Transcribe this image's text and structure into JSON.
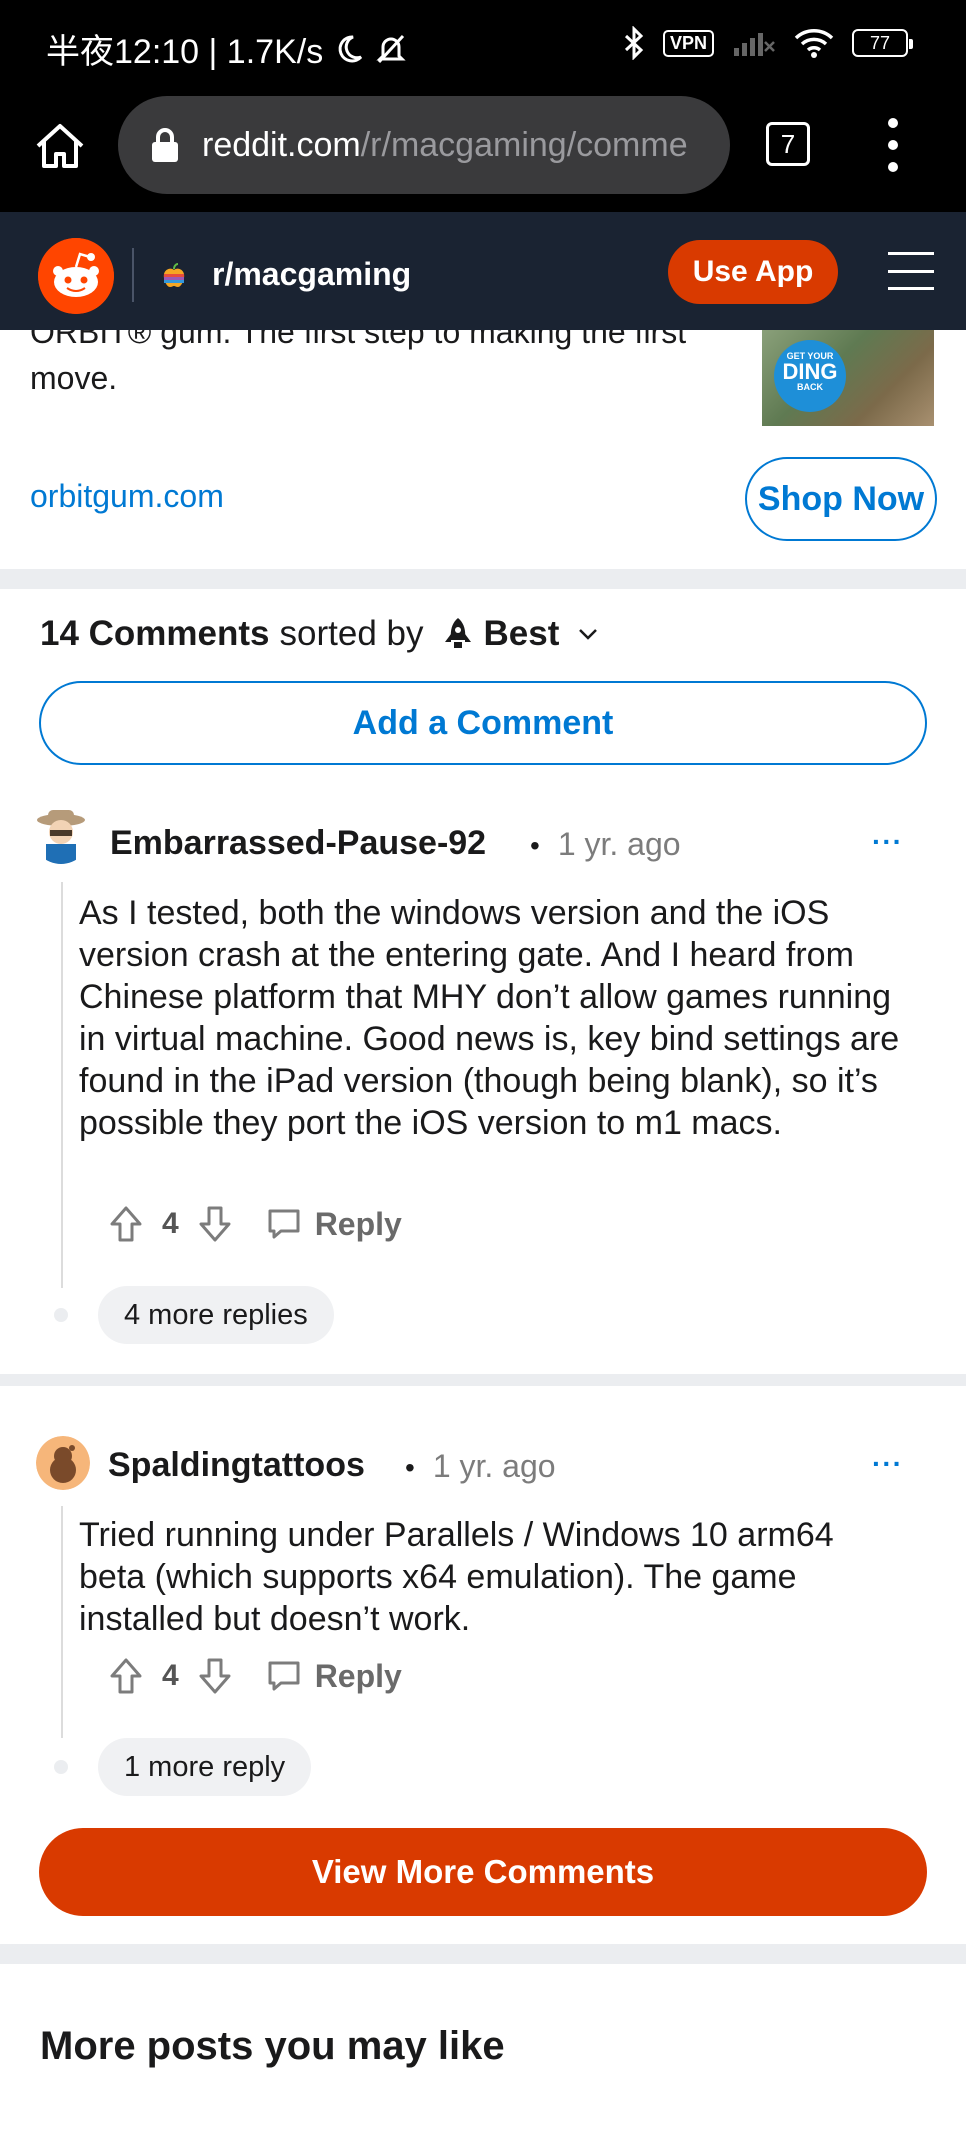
{
  "status_bar": {
    "left_text": "半夜12:10 | 1.7K/s",
    "vpn_label": "VPN",
    "battery": "77"
  },
  "browser": {
    "url_domain": "reddit.com",
    "url_path": "/r/macgaming/comme",
    "tab_count": "7"
  },
  "reddit_header": {
    "subreddit": "r/macgaming",
    "use_app_label": "Use App"
  },
  "ad": {
    "text_line_cut": "ORBIT® gum. The first step to making the first",
    "text_line": "move.",
    "image_badge_top": "GET YOUR",
    "image_badge_main": "DING",
    "image_badge_bottom": "BACK",
    "domain": "orbitgum.com",
    "cta_label": "Shop Now"
  },
  "comments_section": {
    "count_label": "14 Comments",
    "sorted_by_label": "sorted by",
    "sort_value": "Best",
    "add_comment_label": "Add a Comment",
    "view_more_label": "View More Comments"
  },
  "comments": [
    {
      "username": "Embarrassed-Pause-92",
      "age": "1 yr. ago",
      "body": "As I tested, both the windows version and the iOS version crash at the entering gate. And I heard from Chinese platform that MHY don’t allow games running in virtual machine. Good news is, key bind settings are found in the iPad version (though being blank), so it’s possible they port the iOS version to m1 macs.",
      "score": "4",
      "reply_label": "Reply",
      "more_replies": "4 more replies"
    },
    {
      "username": "Spaldingtattoos",
      "age": "1 yr. ago",
      "body": "Tried running under Parallels / Windows 10 arm64 beta (which supports x64 emulation). The game installed but doesn’t work.",
      "score": "4",
      "reply_label": "Reply",
      "more_replies": "1 more reply"
    }
  ],
  "more_posts": {
    "heading": "More posts you may like"
  },
  "colors": {
    "reddit_orange": "#d93a00",
    "link_blue": "#0079d3",
    "header_bg": "#1a2332"
  }
}
